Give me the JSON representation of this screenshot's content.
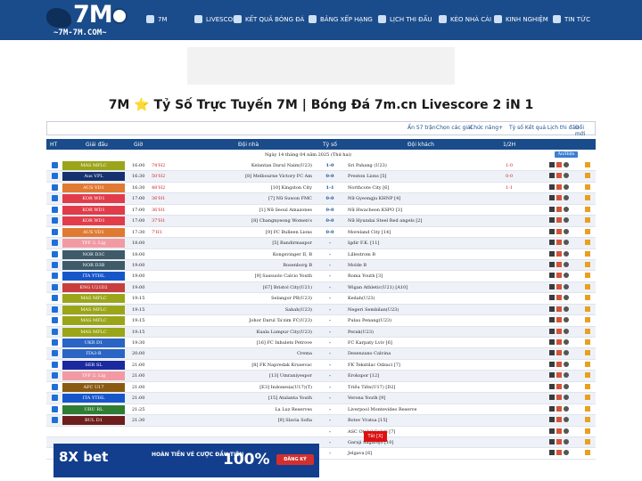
{
  "nav": {
    "logo_big": "7M",
    "logo_sub": "~7M-7M.COM~",
    "items": [
      {
        "label": "7M",
        "icon": "home-icon"
      },
      {
        "label": "LIVESCORE",
        "icon": "tv-icon"
      },
      {
        "label": "KẾT QUẢ BÓNG ĐÁ",
        "icon": "globe-icon"
      },
      {
        "label": "BẢNG XẾP HẠNG",
        "icon": "table-icon"
      },
      {
        "label": "LỊCH THI ĐẤU",
        "icon": "calendar-icon"
      },
      {
        "label": "KÈO NHÀ CÁI",
        "icon": "grid-icon"
      },
      {
        "label": "KINH NGHIỆM",
        "icon": "edit-icon"
      },
      {
        "label": "TIN TỨC",
        "icon": "news-icon"
      }
    ]
  },
  "page_title": "7M ⭐ Tỷ Số Trực Tuyến 7M | Bóng Đá 7m.cn Livescore 2 iN 1",
  "tools": {
    "hidden": "Ẩn 57 trận",
    "pick": "Chọn các giải",
    "features": "Chức năng+",
    "odds": "Tỷ số Kết quả Lịch thi đấu",
    "change": "Đổi mới"
  },
  "headers": {
    "ht": "HT",
    "league": "Giải đấu",
    "time": "Giờ",
    "home": "Đội nhà",
    "score": "Tỷ số",
    "away": "Đội khách",
    "half": "1/2H"
  },
  "date_line": "Ngày 14 tháng 04 năm 2025 (Thứ hai)",
  "date_button": "Ẩn/Hiện",
  "rows": [
    {
      "league": "MAS MFLC",
      "color": "#9aa51a",
      "time": "16:00",
      "status": "74'H2",
      "home": "Kelantan Darul Naim(U23)",
      "score": "1-0",
      "away": "Sri Pahang (U23)",
      "half": "1-0"
    },
    {
      "league": "Aus VPL",
      "color": "#15326e",
      "time": "16:30",
      "status": "50'H2",
      "home": "[8] Melbourne Victory FC Am",
      "score": "0-0",
      "away": "Preston Lions [5]",
      "half": "0-0"
    },
    {
      "league": "AUS VD1",
      "color": "#e07a32",
      "time": "16:30",
      "status": "48'H2",
      "home": "[10] Kingston City",
      "score": "1-1",
      "away": "Northcote City [6]",
      "half": "1-1"
    },
    {
      "league": "KOR WD1",
      "color": "#e23c4a",
      "time": "17:00",
      "status": "36'H1",
      "home": "[7] Nữ Suwon FMC",
      "score": "0-0",
      "away": "Nữ Gyeongju KHNP [4]",
      "half": ""
    },
    {
      "league": "KOR WD1",
      "color": "#e23c4a",
      "time": "17:00",
      "status": "36'H1",
      "home": "[1] Nữ Seoul Amazones",
      "score": "0-0",
      "away": "Nữ Hwacheon KSPO [3]",
      "half": ""
    },
    {
      "league": "KOR WD1",
      "color": "#e23c4a",
      "time": "17:00",
      "status": "37'H1",
      "home": "[8] Changnyeong Women's",
      "score": "0-0",
      "away": "Nữ Hyundai Steel Red angels [2]",
      "half": ""
    },
    {
      "league": "AUS VD1",
      "color": "#e07a32",
      "time": "17:30",
      "status": "7'H1",
      "home": "[9] FC Bulleen Lions",
      "score": "0-0",
      "away": "Moreland City [14]",
      "half": ""
    },
    {
      "league": "TFF 2. Lig",
      "color": "#f29aa3",
      "time": "18:00",
      "status": "",
      "home": "[5] Bandirmaspor",
      "score": "-",
      "away": "Igdir F.K. [11]",
      "half": ""
    },
    {
      "league": "NOR D3C",
      "color": "#3f5b69",
      "time": "18:00",
      "status": "",
      "home": "Kongsvinger II, B",
      "score": "-",
      "away": "Lillestrom B",
      "half": ""
    },
    {
      "league": "NOR D3B",
      "color": "#3f5b69",
      "time": "19:00",
      "status": "",
      "home": "Rosenborg B",
      "score": "-",
      "away": "Molde B",
      "half": ""
    },
    {
      "league": "ITA YTHL",
      "color": "#1756c9",
      "time": "19:00",
      "status": "",
      "home": "[9] Sassuolo Calcio Youth",
      "score": "-",
      "away": "Roma Youth [3]",
      "half": ""
    },
    {
      "league": "ENG U21D2",
      "color": "#c83d3d",
      "time": "19:00",
      "status": "",
      "home": "[67] Bristol City(U21)",
      "score": "-",
      "away": "Wigan Athletic(U21) [A10]",
      "half": ""
    },
    {
      "league": "MAS MFLC",
      "color": "#9aa51a",
      "time": "19:15",
      "status": "",
      "home": "Selangor PB(U23)",
      "score": "-",
      "away": "Kedah(U23)",
      "half": ""
    },
    {
      "league": "MAS MFLC",
      "color": "#9aa51a",
      "time": "19:15",
      "status": "",
      "home": "Sabah(U23)",
      "score": "-",
      "away": "Negeri Sembilan(U23)",
      "half": ""
    },
    {
      "league": "MAS MFLC",
      "color": "#9aa51a",
      "time": "19:15",
      "status": "",
      "home": "Johor Darul Ta'zim FC(U23)",
      "score": "-",
      "away": "Pulau Penang(U23)",
      "half": ""
    },
    {
      "league": "MAS MFLC",
      "color": "#9aa51a",
      "time": "19:15",
      "status": "",
      "home": "Kuala Lumpur City(U23)",
      "score": "-",
      "away": "Perak(U23)",
      "half": ""
    },
    {
      "league": "UKR D1",
      "color": "#2a64c4",
      "time": "19:30",
      "status": "",
      "home": "[16] FC Inhulets Petrove",
      "score": "-",
      "away": "FC Karpaty Lviv [6]",
      "half": ""
    },
    {
      "league": "ITA3-B",
      "color": "#2a64c4",
      "time": "20:00",
      "status": "",
      "home": "Crema",
      "score": "-",
      "away": "Desenzano Calvina",
      "half": ""
    },
    {
      "league": "SER SL",
      "color": "#1b2a9e",
      "time": "21:00",
      "status": "",
      "home": "[8] FK Napredak Krusevac",
      "score": "-",
      "away": "FK Tekstilac Odzaci [7]",
      "half": ""
    },
    {
      "league": "TFF 2. Lig",
      "color": "#f29aa3",
      "time": "21:00",
      "status": "",
      "home": "[13] Umraniyespor",
      "score": "-",
      "away": "Erokspor [12]",
      "half": ""
    },
    {
      "league": "AFC U17",
      "color": "#8a5a12",
      "time": "21:00",
      "status": "",
      "home": "[E3] Indonesia(U17)(T)",
      "score": "-",
      "away": "Triều Tiên(U17) [D2]",
      "half": ""
    },
    {
      "league": "ITA YTHL",
      "color": "#1756c9",
      "time": "21:00",
      "status": "",
      "home": "[15] Atalanta Youth",
      "score": "-",
      "away": "Verona Youth [9]",
      "half": ""
    },
    {
      "league": "URU RL",
      "color": "#2e7d32",
      "time": "21:25",
      "status": "",
      "home": "La Luz Reserves",
      "score": "-",
      "away": "Liverpool Montevideo Reserve",
      "half": ""
    },
    {
      "league": "BUL D1",
      "color": "#6e1e1e",
      "time": "21:30",
      "status": "",
      "home": "[9] Slavia Sofia",
      "score": "-",
      "away": "Botev Vratsa [15]",
      "half": ""
    },
    {
      "league": "",
      "color": "#ffffff",
      "time": "",
      "status": "",
      "home": "",
      "score": "-",
      "away": "ASC Oțelul Galati [7]",
      "half": ""
    },
    {
      "league": "",
      "color": "#ffffff",
      "time": "",
      "status": "",
      "home": "",
      "score": "-",
      "away": "Garaji Sagarejo [10]",
      "half": ""
    },
    {
      "league": "",
      "color": "#ffffff",
      "time": "",
      "status": "",
      "home": "",
      "score": "-",
      "away": "Jelgava [6]",
      "half": ""
    }
  ],
  "ad": {
    "brand": "8X bet",
    "text": "HOÀN TIỀN VÉ CƯỢC ĐẦU TIÊN",
    "percent": "100%",
    "cta": "ĐĂNG KÝ",
    "close": "Tắt [X]"
  }
}
